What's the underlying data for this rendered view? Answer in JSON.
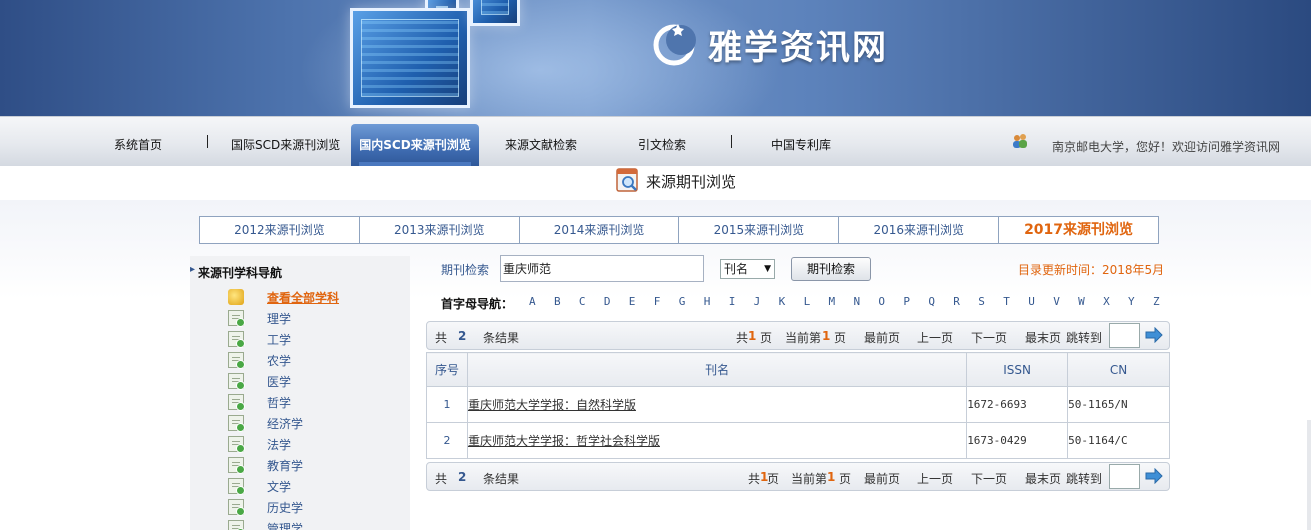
{
  "site": {
    "name": "雅学资讯网"
  },
  "nav": {
    "items": [
      "系统首页",
      "国际SCD来源刊浏览",
      "国内SCD来源刊浏览",
      "来源文献检索",
      "引文检索",
      "中国专利库"
    ],
    "active": "国内SCD来源刊浏览",
    "welcome": "南京邮电大学，您好！欢迎访问雅学资讯网"
  },
  "page": {
    "title": "来源期刊浏览"
  },
  "years": [
    "2012来源刊浏览",
    "2013来源刊浏览",
    "2014来源刊浏览",
    "2015来源刊浏览",
    "2016来源刊浏览",
    "2017来源刊浏览"
  ],
  "active_year": "2017来源刊浏览",
  "sidebar": {
    "heading": "来源刊学科导航",
    "all_label": "查看全部学科",
    "subjects": [
      "理学",
      "工学",
      "农学",
      "医学",
      "哲学",
      "经济学",
      "法学",
      "教育学",
      "文学",
      "历史学",
      "管理学"
    ]
  },
  "search": {
    "label": "期刊检索",
    "value": "重庆师范",
    "select_value": "刊名",
    "button": "期刊检索",
    "update_time": "目录更新时间：2018年5月"
  },
  "letters": {
    "label": "首字母导航：",
    "items": [
      "A",
      "B",
      "C",
      "D",
      "E",
      "F",
      "G",
      "H",
      "I",
      "J",
      "K",
      "L",
      "M",
      "N",
      "O",
      "P",
      "Q",
      "R",
      "S",
      "T",
      "U",
      "V",
      "W",
      "X",
      "Y",
      "Z"
    ]
  },
  "pager_top": {
    "total_prefix": "共",
    "total": "2",
    "total_suffix": "条结果",
    "pages_prefix": "共",
    "pages": "1",
    "pages_suffix": "页",
    "current_prefix": "当前第",
    "current": "1",
    "current_suffix": "页",
    "first": "最前页",
    "prev": "上一页",
    "next": "下一页",
    "last": "最末页",
    "jump": "跳转到"
  },
  "pager_bottom": {
    "total_prefix": "共",
    "total": "2",
    "total_suffix": "条结果",
    "pages_prefix": "共",
    "pages": "1",
    "pages_suffix": "页",
    "current_prefix": "当前第",
    "current": "1",
    "current_suffix": "页",
    "first": "最前页",
    "prev": "上一页",
    "next": "下一页",
    "last": "最末页",
    "jump": "跳转到"
  },
  "table": {
    "headers": [
      "序号",
      "刊名",
      "ISSN",
      "CN"
    ],
    "rows": [
      {
        "idx": "1",
        "title": "重庆师范大学学报：自然科学版",
        "issn": "1672-6693",
        "cn": "50-1165/N"
      },
      {
        "idx": "2",
        "title": "重庆师范大学学报：哲学社会科学版",
        "issn": "1673-0429",
        "cn": "50-1164/C"
      }
    ]
  },
  "colors": {
    "accent": "#e0650f",
    "link": "#35588f",
    "nav_active": "#3e6bb0"
  }
}
